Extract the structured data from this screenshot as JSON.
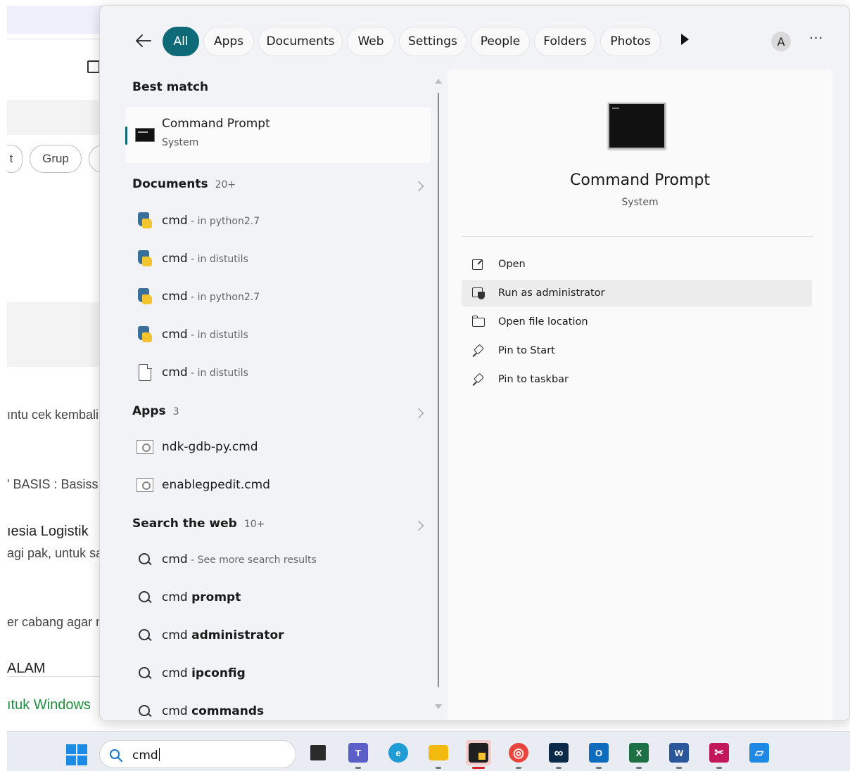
{
  "background": {
    "chips": [
      "t",
      "Grup"
    ],
    "snippets": [
      "ıntu cek kembali",
      "' BASIS : Basiss",
      "ıesia Logistik",
      "agi pak, untuk sa",
      "er cabang agar n",
      "ALAM",
      "ıtuk Windows"
    ]
  },
  "filters": {
    "back": "←",
    "tabs": [
      "All",
      "Apps",
      "Documents",
      "Web",
      "Settings",
      "People",
      "Folders",
      "Photos"
    ],
    "avatar": "A",
    "more": "···"
  },
  "results": {
    "best_match": {
      "heading": "Best match",
      "title": "Command Prompt",
      "subtitle": "System"
    },
    "documents": {
      "heading": "Documents",
      "count": "20+",
      "items": [
        {
          "name": "cmd",
          "loc": " - in python2.7",
          "icon": "python-file-icon"
        },
        {
          "name": "cmd",
          "loc": " - in distutils",
          "icon": "python-file-icon"
        },
        {
          "name": "cmd",
          "loc": " - in python2.7",
          "icon": "python-file-icon"
        },
        {
          "name": "cmd",
          "loc": " - in distutils",
          "icon": "python-file-icon"
        },
        {
          "name": "cmd",
          "loc": " - in distutils",
          "icon": "document-icon"
        }
      ]
    },
    "apps": {
      "heading": "Apps",
      "count": "3",
      "items": [
        {
          "name": "ndk-gdb-py.cmd",
          "icon": "cmd-file-icon"
        },
        {
          "name": "enablegpedit.cmd",
          "icon": "cmd-file-icon"
        }
      ]
    },
    "web": {
      "heading": "Search the web",
      "count": "10+",
      "items": [
        {
          "prefix": "cmd",
          "rest": " - See more search results",
          "style": "sub"
        },
        {
          "prefix": "cmd ",
          "rest": "prompt",
          "style": "bold"
        },
        {
          "prefix": "cmd ",
          "rest": "administrator",
          "style": "bold"
        },
        {
          "prefix": "cmd ",
          "rest": "ipconfig",
          "style": "bold"
        },
        {
          "prefix": "cmd ",
          "rest": "commands",
          "style": "bold"
        }
      ]
    }
  },
  "details": {
    "title": "Command Prompt",
    "subtitle": "System",
    "actions": [
      {
        "label": "Open",
        "icon": "open-icon"
      },
      {
        "label": "Run as administrator",
        "icon": "run-as-admin-icon"
      },
      {
        "label": "Open file location",
        "icon": "folder-icon"
      },
      {
        "label": "Pin to Start",
        "icon": "pin-icon"
      },
      {
        "label": "Pin to taskbar",
        "icon": "pin-icon"
      }
    ]
  },
  "taskbar": {
    "search_text": "cmd",
    "apps": [
      {
        "name": "task-view",
        "color": "#2b2b2b",
        "glyph": ""
      },
      {
        "name": "teams",
        "color": "#5b5fc7",
        "glyph": "T"
      },
      {
        "name": "edge",
        "color": "#1f9bd6",
        "glyph": "e"
      },
      {
        "name": "file-explorer",
        "color": "#f2b90f",
        "glyph": ""
      },
      {
        "name": "sticky-notes",
        "color": "#1f1f1f",
        "glyph": "",
        "active": true
      },
      {
        "name": "chrome",
        "color": "#e8453c",
        "glyph": "◎"
      },
      {
        "name": "webex",
        "color": "#0b2a4a",
        "glyph": "∞"
      },
      {
        "name": "outlook",
        "color": "#0f6cbd",
        "glyph": "O"
      },
      {
        "name": "excel",
        "color": "#1d7044",
        "glyph": "X"
      },
      {
        "name": "word",
        "color": "#2b579a",
        "glyph": "W"
      },
      {
        "name": "snipping-tool",
        "color": "#c2185b",
        "glyph": "✂"
      },
      {
        "name": "pen-app",
        "color": "#1e88e5",
        "glyph": "▱"
      }
    ]
  }
}
